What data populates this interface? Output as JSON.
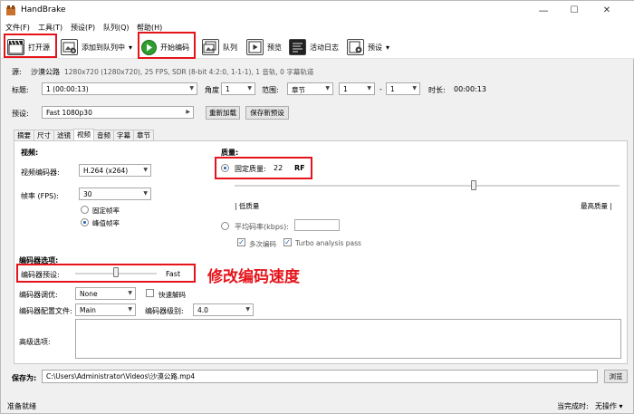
{
  "window": {
    "title": "HandBrake",
    "min": "—",
    "max": "☐",
    "close": "✕"
  },
  "menu": [
    "文件(F)",
    "工具(T)",
    "预设(P)",
    "队列(Q)",
    "帮助(H)"
  ],
  "toolbar": {
    "open_source": "打开源",
    "add_to_queue": "添加到队列中",
    "start_encode": "开始编码",
    "queue": "队列",
    "preview": "预览",
    "activity_log": "活动日志",
    "presets": "预设",
    "dropdown": "▾"
  },
  "source": {
    "label": "源:",
    "name": "沙漠公路",
    "info": "1280x720 (1280x720), 25 FPS, SDR (8-bit 4:2:0, 1-1-1), 1 音轨, 0 字幕轨道"
  },
  "title_row": {
    "title_label": "标题:",
    "title_value": "1 (00:00:13)",
    "angle_label": "角度",
    "angle_value": "1",
    "range_label": "范围:",
    "range_type": "章节",
    "range_start": "1",
    "range_sep": "-",
    "range_end": "1",
    "duration_label": "时长:",
    "duration_value": "00:00:13"
  },
  "preset_row": {
    "label": "预设:",
    "value": "Fast 1080p30",
    "reload": "重新加载",
    "save_new": "保存新预设"
  },
  "tabs": [
    "摘要",
    "尺寸",
    "滤镜",
    "视频",
    "音频",
    "字幕",
    "章节"
  ],
  "video": {
    "section": "视频:",
    "encoder_label": "视频编码器:",
    "encoder_value": "H.264 (x264)",
    "fps_label": "帧率 (FPS):",
    "fps_value": "30",
    "const_fps": "固定帧率",
    "peak_fps": "峰值帧率"
  },
  "quality": {
    "section": "质量:",
    "const_quality": "固定质量:",
    "rf_value": "22",
    "rf_unit": "RF",
    "low": "| 低质量",
    "high": "最高质量 |",
    "avg_bitrate": "平均码率(kbps):",
    "multipass": "多次编码",
    "turbo": "Turbo analysis pass",
    "slider_fraction": 0.62
  },
  "encoder_options": {
    "section": "编码器选项:",
    "preset_label": "编码器预设:",
    "preset_value": "Fast",
    "preset_fraction": 0.5,
    "tune_label": "编码器调优:",
    "tune_value": "None",
    "fast_decode": "快速解码",
    "profile_label": "编码器配置文件:",
    "profile_value": "Main",
    "level_label": "编码器级别:",
    "level_value": "4.0",
    "advanced_label": "高级选项:"
  },
  "annotation": "修改编码速度",
  "save": {
    "label": "保存为:",
    "path": "C:\\Users\\Administrator\\Videos\\沙漠公路.mp4",
    "browse": "浏览"
  },
  "status": {
    "left": "准备就绪",
    "when_done_label": "当完成时:",
    "when_done_value": "无操作 ▾"
  },
  "colors": {
    "highlight_red": "#e5141b",
    "annotation_red": "#e5141b",
    "radio_blue": "#1a5fb4",
    "play_green": "#2e9e2e"
  }
}
